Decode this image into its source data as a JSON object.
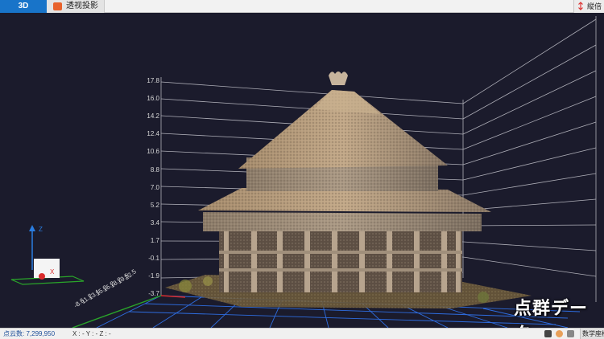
{
  "tabs": {
    "view_3d": "3D",
    "projection": "透视投影"
  },
  "topright": {
    "label": "縦倍"
  },
  "y_axis": {
    "ticks": [
      "17.8",
      "16.0",
      "14.2",
      "12.4",
      "10.6",
      "8.8",
      "7.0",
      "5.2",
      "3.4",
      "1.7",
      "-0.1",
      "-1.9",
      "-3.7"
    ]
  },
  "x_axis": {
    "ticks": [
      "-8.6",
      "11.2",
      "13.1",
      "15.2",
      "16.2",
      "18.2",
      "19.5",
      "22.5"
    ]
  },
  "gizmo": {
    "z_label": "Z",
    "x_label": "X"
  },
  "watermark": "点群データ",
  "status": {
    "points_label": "点云数: 7,299,950",
    "coords": "X : - Y : - Z : -",
    "coord_system": "数学座標"
  },
  "colors": {
    "accent_tab": "#1874c9",
    "viewport_bg": "#1b1b2c",
    "axis_x": "#d92c2c",
    "axis_y": "#2aa52a",
    "axis_z": "#2a7de0",
    "ground_grid": "#2e6de0"
  }
}
